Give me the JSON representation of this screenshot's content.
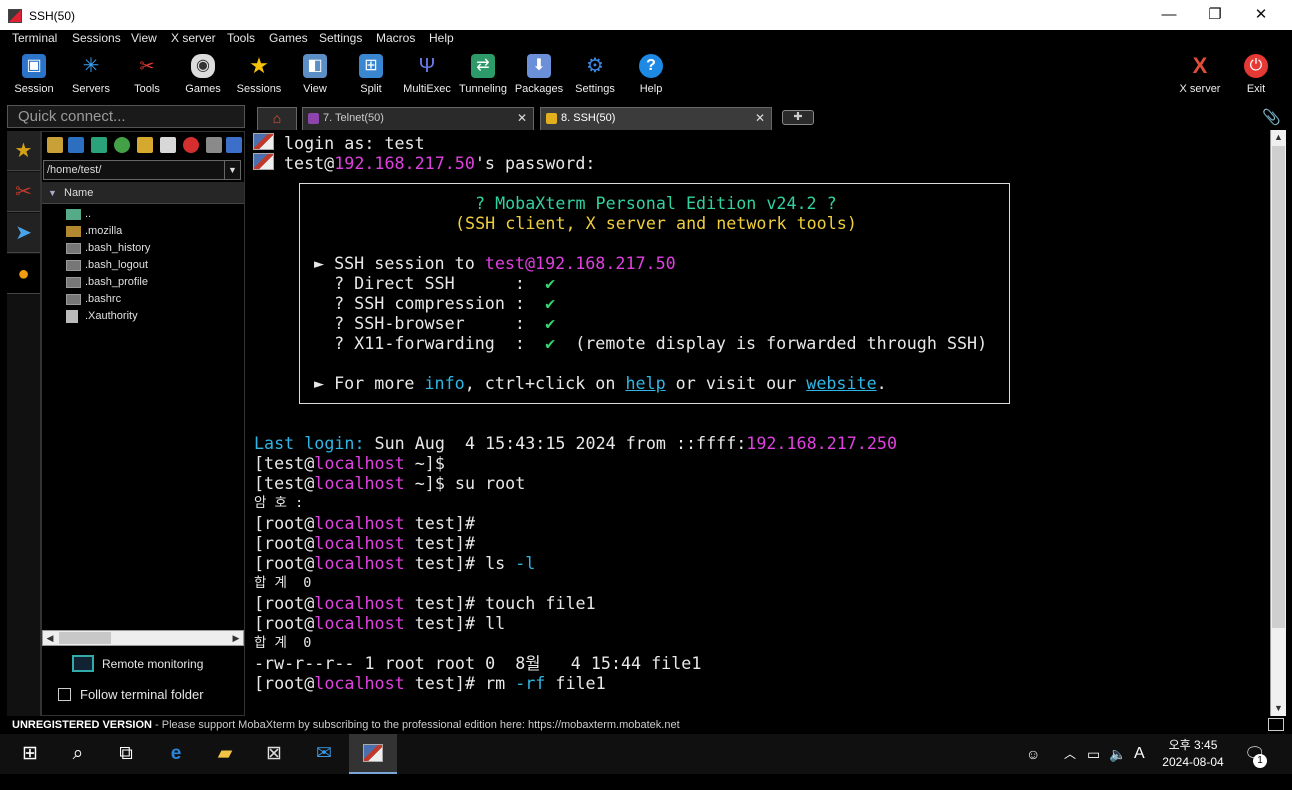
{
  "window": {
    "title": "SSH(50)",
    "minimize": "—",
    "maximize": "❐",
    "close": "✕"
  },
  "menu": [
    "Terminal",
    "Sessions",
    "View",
    "X server",
    "Tools",
    "Games",
    "Settings",
    "Macros",
    "Help"
  ],
  "toolbar": {
    "session": "Session",
    "servers": "Servers",
    "tools": "Tools",
    "games": "Games",
    "sessions": "Sessions",
    "view": "View",
    "split": "Split",
    "multiexec": "MultiExec",
    "tunneling": "Tunneling",
    "packages": "Packages",
    "settings": "Settings",
    "help": "Help",
    "xserver": "X server",
    "exit": "Exit"
  },
  "quick_connect": {
    "placeholder": "Quick connect..."
  },
  "tabs": [
    {
      "label": "7. Telnet(50)",
      "active": false
    },
    {
      "label": "8. SSH(50)",
      "active": true
    }
  ],
  "file_browser": {
    "path": "/home/test/",
    "column": "Name",
    "items": [
      "..",
      ".mozilla",
      ".bash_history",
      ".bash_logout",
      ".bash_profile",
      ".bashrc",
      ".Xauthority"
    ],
    "remote_monitoring": "Remote monitoring",
    "follow_folder": "Follow terminal folder"
  },
  "terminal": {
    "login_prefix": "login as: ",
    "login_user": "test",
    "pw_user": "test@",
    "pw_host": "192.168.217.50",
    "pw_suffix": "'s password:",
    "banner_title": "? MobaXterm Personal Edition v24.2 ?",
    "banner_subtitle": "(SSH client, X server and network tools)",
    "ssh_session_prefix": "► SSH session to ",
    "ssh_session_target": "test@192.168.217.50",
    "direct_ssh": "  ? Direct SSH      :  ",
    "ssh_compression": "  ? SSH compression :  ",
    "ssh_browser": "  ? SSH-browser     :  ",
    "x11": "  ? X11-forwarding  :  ",
    "check": "✔",
    "x11_note": "  (remote display is forwarded through SSH)",
    "more_prefix": "► For more ",
    "more_info": "info",
    "more_mid": ", ctrl+click on ",
    "more_help": "help",
    "more_mid2": " or visit our ",
    "more_website": "website",
    "more_end": ".",
    "last_login_label": "Last login:",
    "last_login_text": " Sun Aug  4 15:43:15 2024 from ::ffff:",
    "last_login_ip": "192.168.217.250",
    "host": "localhost",
    "p1_user": "[test@",
    "p1_end": " ~]$",
    "p2_cmd": " ~]$ su root",
    "pw_ko": "암 호 :",
    "root_user": "[root@",
    "root_end": " test]#",
    "ls_cmd": " test]# ls ",
    "ls_flag": "-l",
    "total_ko": "합 계  0",
    "touch_cmd": " test]# touch file1",
    "ll_cmd": " test]# ll",
    "ls_output": "-rw-r--r-- 1 root root 0  8월   4 15:44 file1",
    "rm_cmd": " test]# rm ",
    "rm_flag": "-rf",
    "rm_arg": " file1"
  },
  "status": {
    "unregistered": "UNREGISTERED VERSION",
    "message": "  -  Please support MobaXterm by subscribing to the professional edition here:  https://mobaxterm.mobatek.net"
  },
  "taskbar": {
    "time": "오후 3:45",
    "date": "2024-08-04",
    "ime": "A",
    "notifications": "1"
  }
}
